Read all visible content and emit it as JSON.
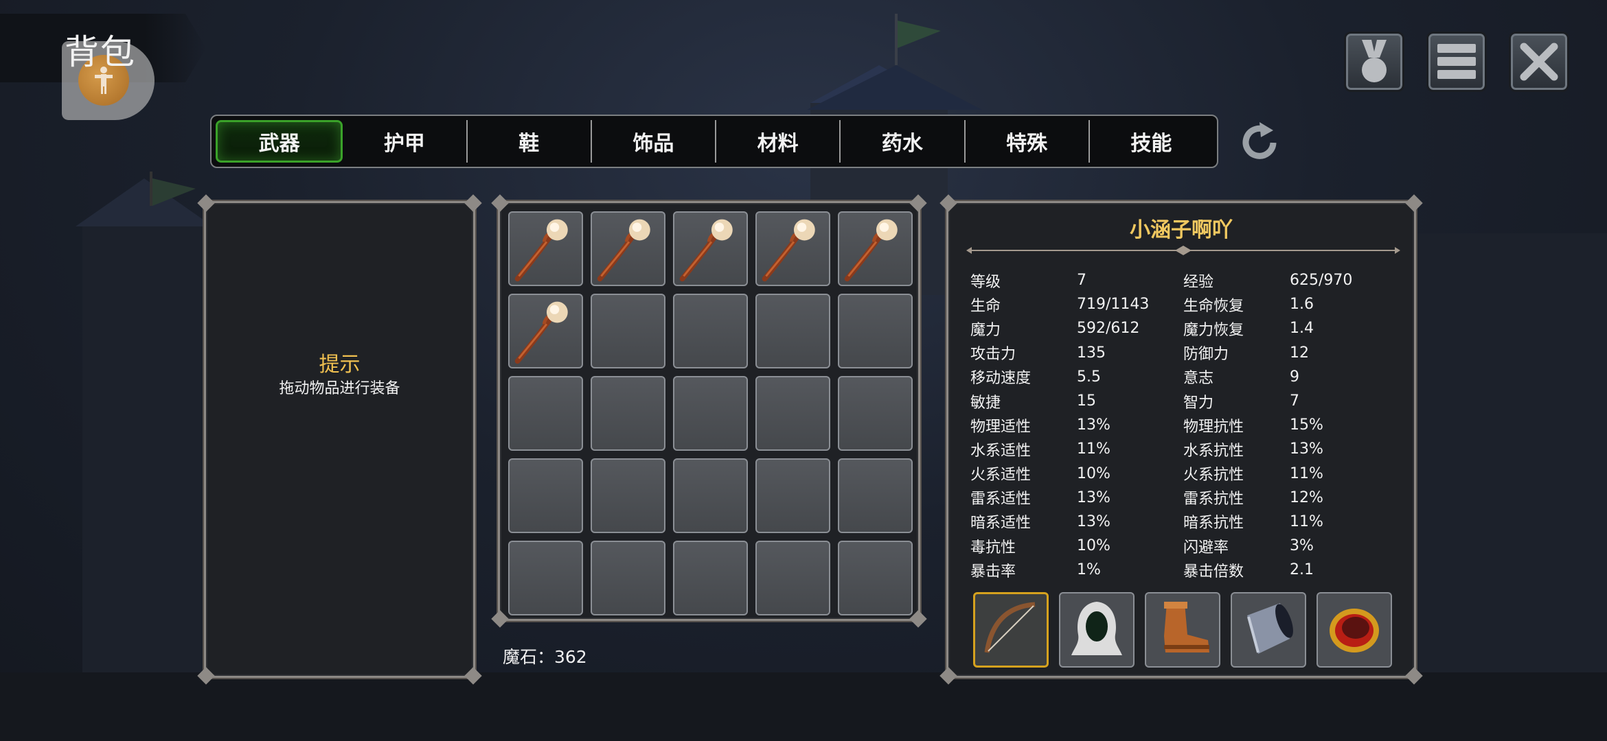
{
  "header": {
    "title": "背包"
  },
  "tabs": [
    {
      "label": "武器",
      "active": true
    },
    {
      "label": "护甲",
      "active": false
    },
    {
      "label": "鞋",
      "active": false
    },
    {
      "label": "饰品",
      "active": false
    },
    {
      "label": "材料",
      "active": false
    },
    {
      "label": "药水",
      "active": false
    },
    {
      "label": "特殊",
      "active": false
    },
    {
      "label": "技能",
      "active": false
    }
  ],
  "hint": {
    "title": "提示",
    "text": "拖动物品进行装备"
  },
  "inventory": {
    "slots": [
      "staff",
      "staff",
      "staff",
      "staff",
      "staff",
      "staff",
      "",
      "",
      "",
      "",
      "",
      "",
      "",
      "",
      "",
      "",
      "",
      "",
      "",
      "",
      "",
      "",
      "",
      "",
      ""
    ]
  },
  "currency": {
    "text": "魔石：362"
  },
  "character": {
    "name": "小涵子啊吖",
    "stats": [
      [
        "等级",
        "7",
        "经验",
        "625/970"
      ],
      [
        "生命",
        "719/1143",
        "生命恢复",
        "1.6"
      ],
      [
        "魔力",
        "592/612",
        "魔力恢复",
        "1.4"
      ],
      [
        "攻击力",
        "135",
        "防御力",
        "12"
      ],
      [
        "移动速度",
        "5.5",
        "意志",
        "9"
      ],
      [
        "敏捷",
        "15",
        "智力",
        "7"
      ],
      [
        "物理适性",
        "13%",
        "物理抗性",
        "15%"
      ],
      [
        "水系适性",
        "11%",
        "水系抗性",
        "13%"
      ],
      [
        "火系适性",
        "10%",
        "火系抗性",
        "11%"
      ],
      [
        "雷系适性",
        "13%",
        "雷系抗性",
        "12%"
      ],
      [
        "暗系适性",
        "13%",
        "暗系抗性",
        "11%"
      ],
      [
        "毒抗性",
        "10%",
        "闪避率",
        "3%"
      ],
      [
        "暴击率",
        "1%",
        "暴击倍数",
        "2.1"
      ]
    ],
    "equipment": [
      "bow-icon",
      "hood-icon",
      "boots-icon",
      "bracer-icon",
      "ring-icon"
    ]
  },
  "colors": {
    "accent_green": "#3aa229",
    "gold": "#f0c050",
    "selected": "#d6a21e"
  }
}
